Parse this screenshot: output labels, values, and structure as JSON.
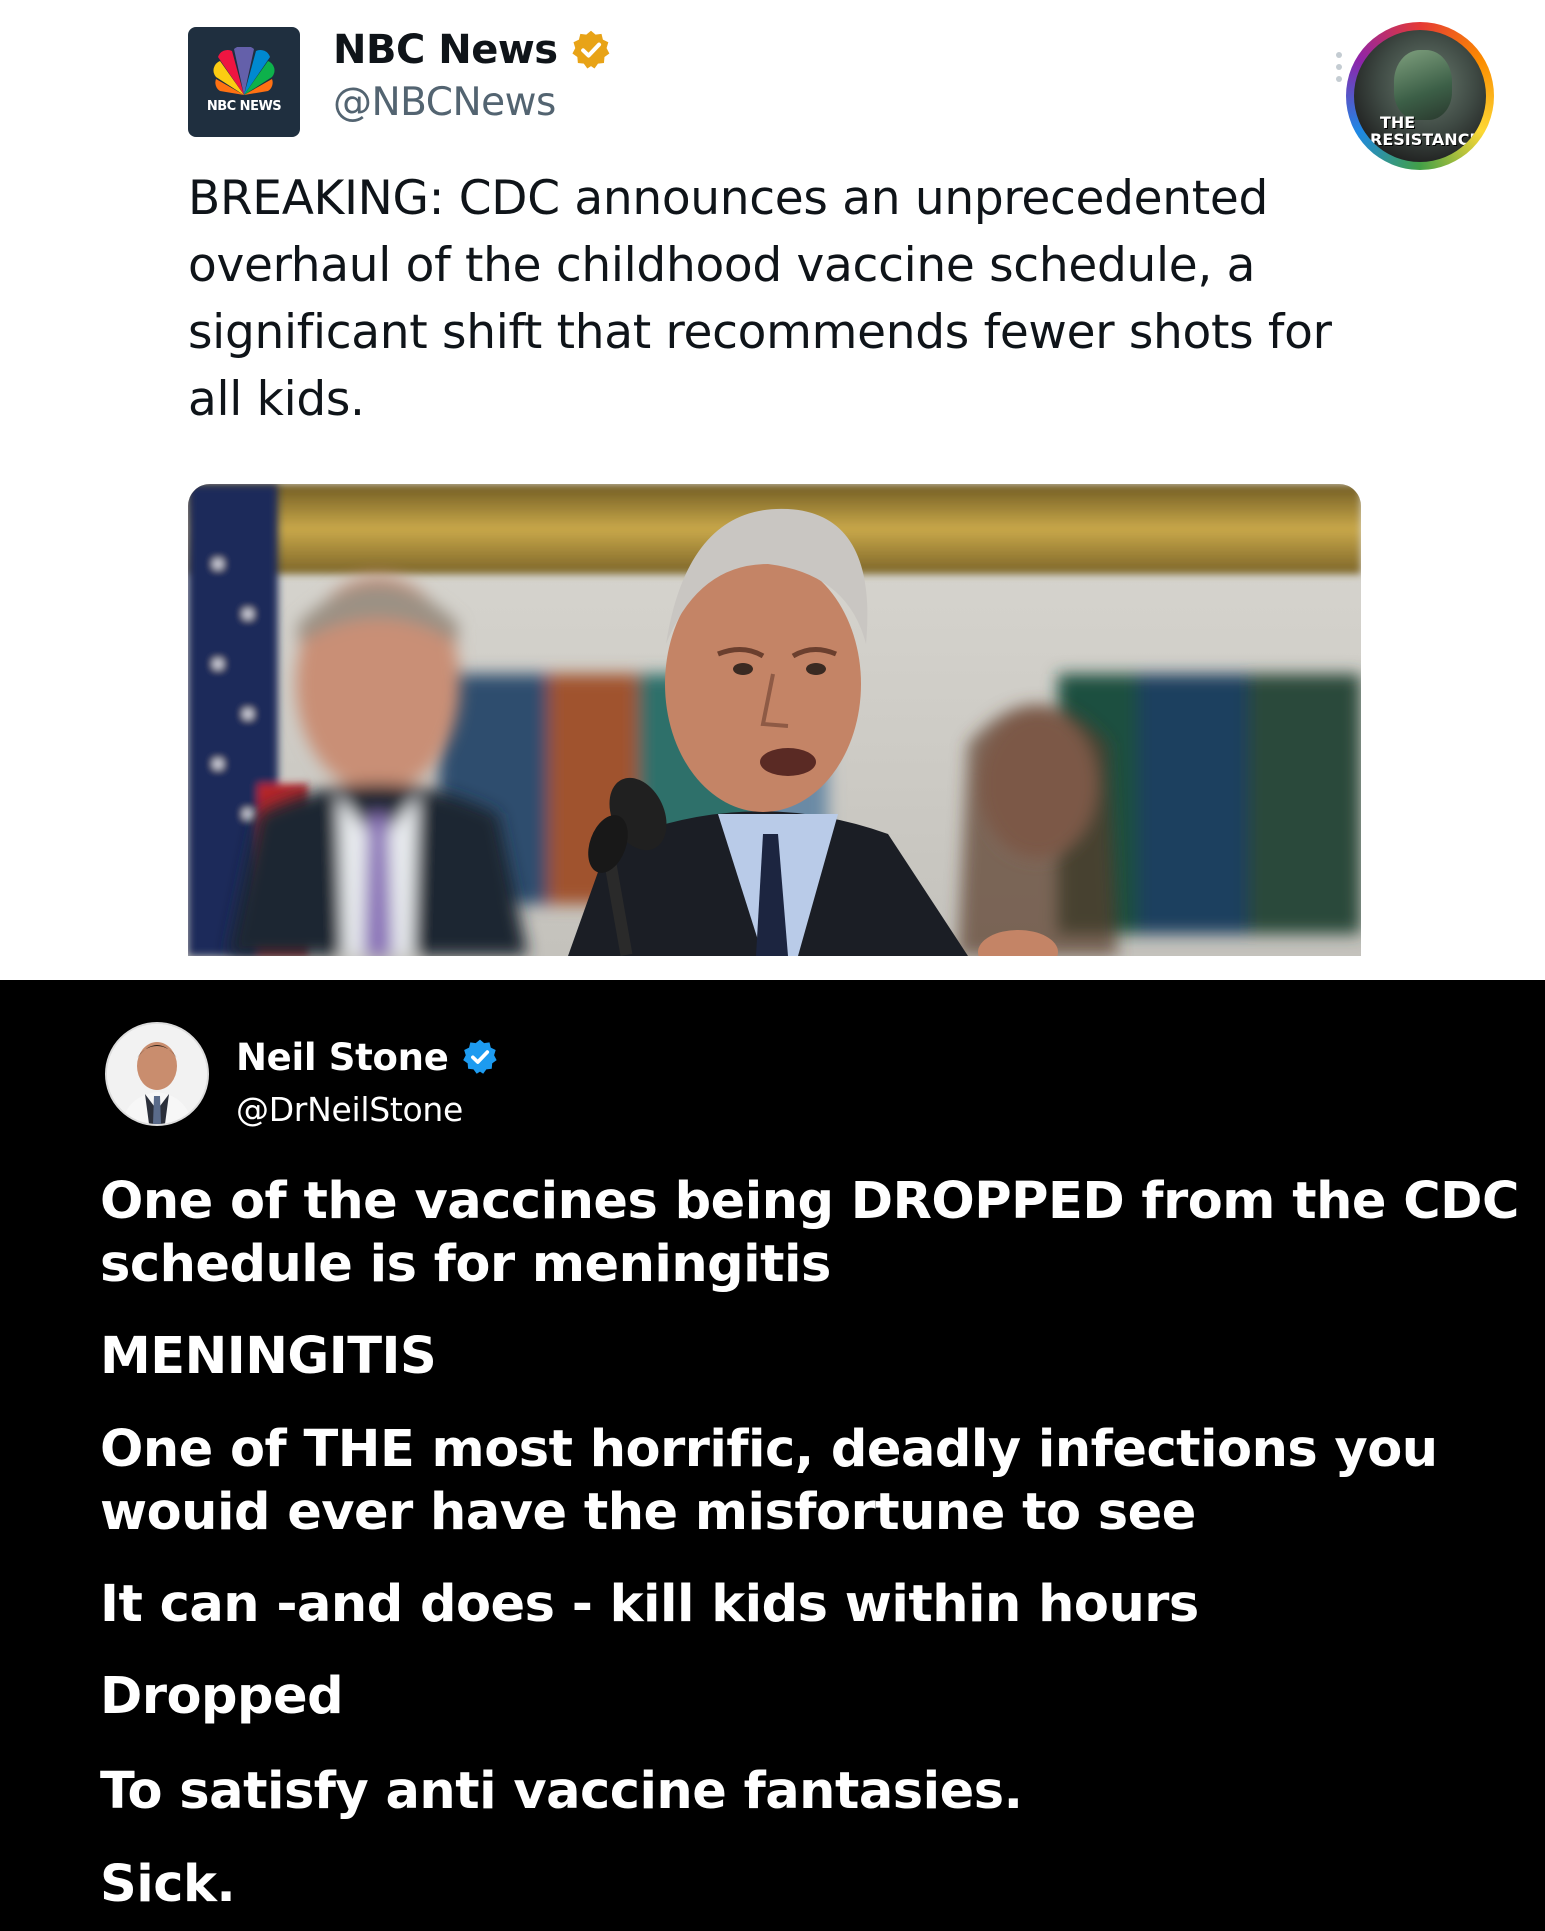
{
  "nbc_tweet": {
    "display_name": "NBC News",
    "handle": "@NBCNews",
    "avatar_label": "NBC NEWS",
    "verified_badge": "gold-verified-badge-icon",
    "text": "BREAKING: CDC announces an unprecedented overhaul of the childhood vaccine schedule, a significant shift that recommends fewer shots for all kids.",
    "photo": "photo-press-conference"
  },
  "watermark": {
    "line1": "THE",
    "line2": "RESISTANCE",
    "colors": [
      "#e53935",
      "#fb8c00",
      "#fdd835",
      "#43a047",
      "#1e88e5",
      "#8e24aa"
    ]
  },
  "reply_tweet": {
    "display_name": "Neil Stone",
    "handle": "@DrNeilStone",
    "verified_badge": "blue-verified-badge-icon",
    "lines": [
      "One of the vaccines being DROPPED from the CDC schedule is for meningitis",
      "MENINGITIS",
      "One of THE most horrific, deadly infections you wouid ever have the misfortune to see",
      "It can -and does - kill kids within hours",
      "Dropped",
      "To satisfy anti vaccine fantasies.",
      "Sick."
    ]
  },
  "colors": {
    "gold_badge": "#e8a317",
    "blue_badge": "#1d9bf0",
    "handle_gray": "#536471",
    "dark_bg": "#000000"
  }
}
